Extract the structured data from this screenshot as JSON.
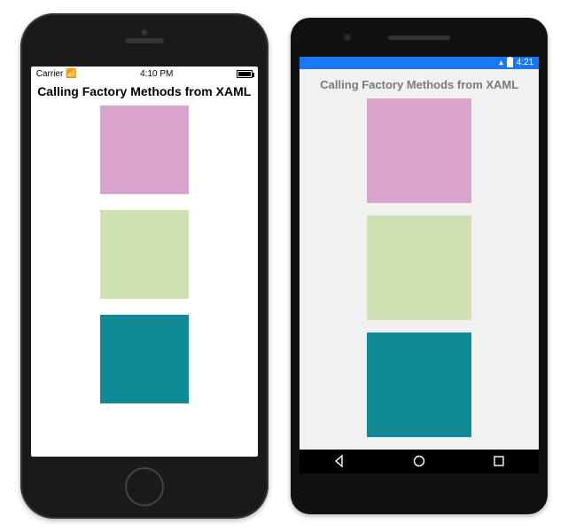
{
  "ios": {
    "status": {
      "carrier": "Carrier",
      "time": "4:10 PM"
    },
    "title": "Calling Factory Methods from XAML"
  },
  "android": {
    "status": {
      "time": "4:21"
    },
    "title": "Calling Factory Methods from XAML"
  },
  "colors": {
    "box1": "#d9a3cc",
    "box2": "#cfe1b3",
    "box3": "#0d8a93"
  }
}
